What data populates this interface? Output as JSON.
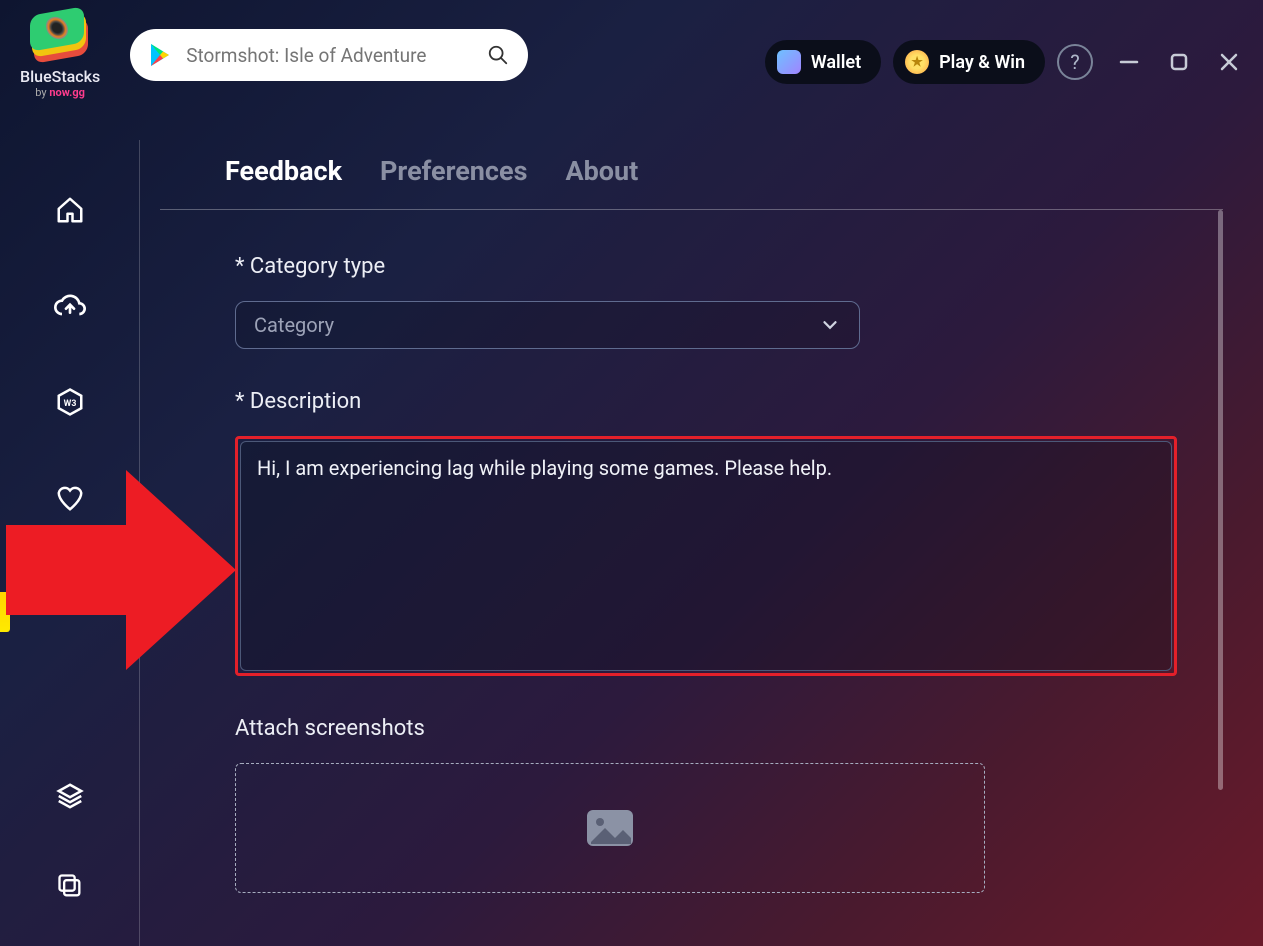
{
  "logo": {
    "name": "BlueStacks",
    "byline_prefix": "by ",
    "byline_brand": "now.gg"
  },
  "search": {
    "placeholder": "Stormshot: Isle of Adventure",
    "value": ""
  },
  "topbuttons": {
    "wallet": "Wallet",
    "playwin": "Play & Win"
  },
  "tabs": {
    "feedback": "Feedback",
    "preferences": "Preferences",
    "about": "About"
  },
  "form": {
    "category_label": "* Category type",
    "category_placeholder": "Category",
    "description_label": "* Description",
    "description_value": "Hi, I am experiencing lag while playing some games. Please help.",
    "attach_label": "Attach screenshots"
  }
}
